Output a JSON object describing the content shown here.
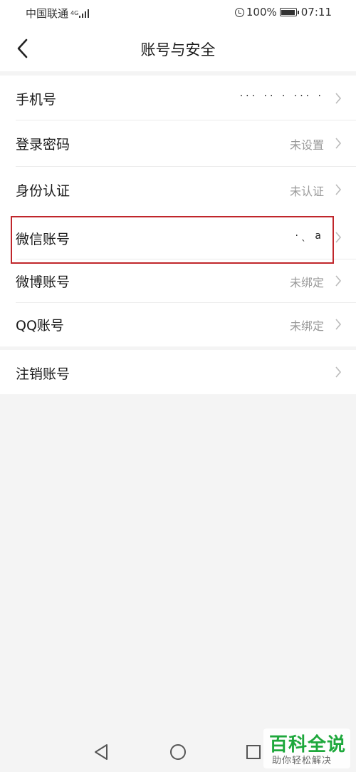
{
  "status_bar": {
    "carrier": "中国联通",
    "network": "4G",
    "battery": "100%",
    "time": "07:11"
  },
  "header": {
    "title": "账号与安全"
  },
  "rows": [
    {
      "label": "手机号",
      "value": "··· ·· · ··· ·"
    },
    {
      "label": "登录密码",
      "value": "未设置"
    },
    {
      "label": "身份认证",
      "value": "未认证"
    },
    {
      "label": "微信账号",
      "value": "·ˎ a"
    },
    {
      "label": "微博账号",
      "value": "未绑定"
    },
    {
      "label": "QQ账号",
      "value": "未绑定"
    },
    {
      "label": "注销账号",
      "value": ""
    }
  ],
  "colors": {
    "highlight": "#c0262b",
    "watermark": "#1ea83c"
  },
  "watermark": {
    "title": "百科全说",
    "subtitle": "助你轻松解决"
  }
}
